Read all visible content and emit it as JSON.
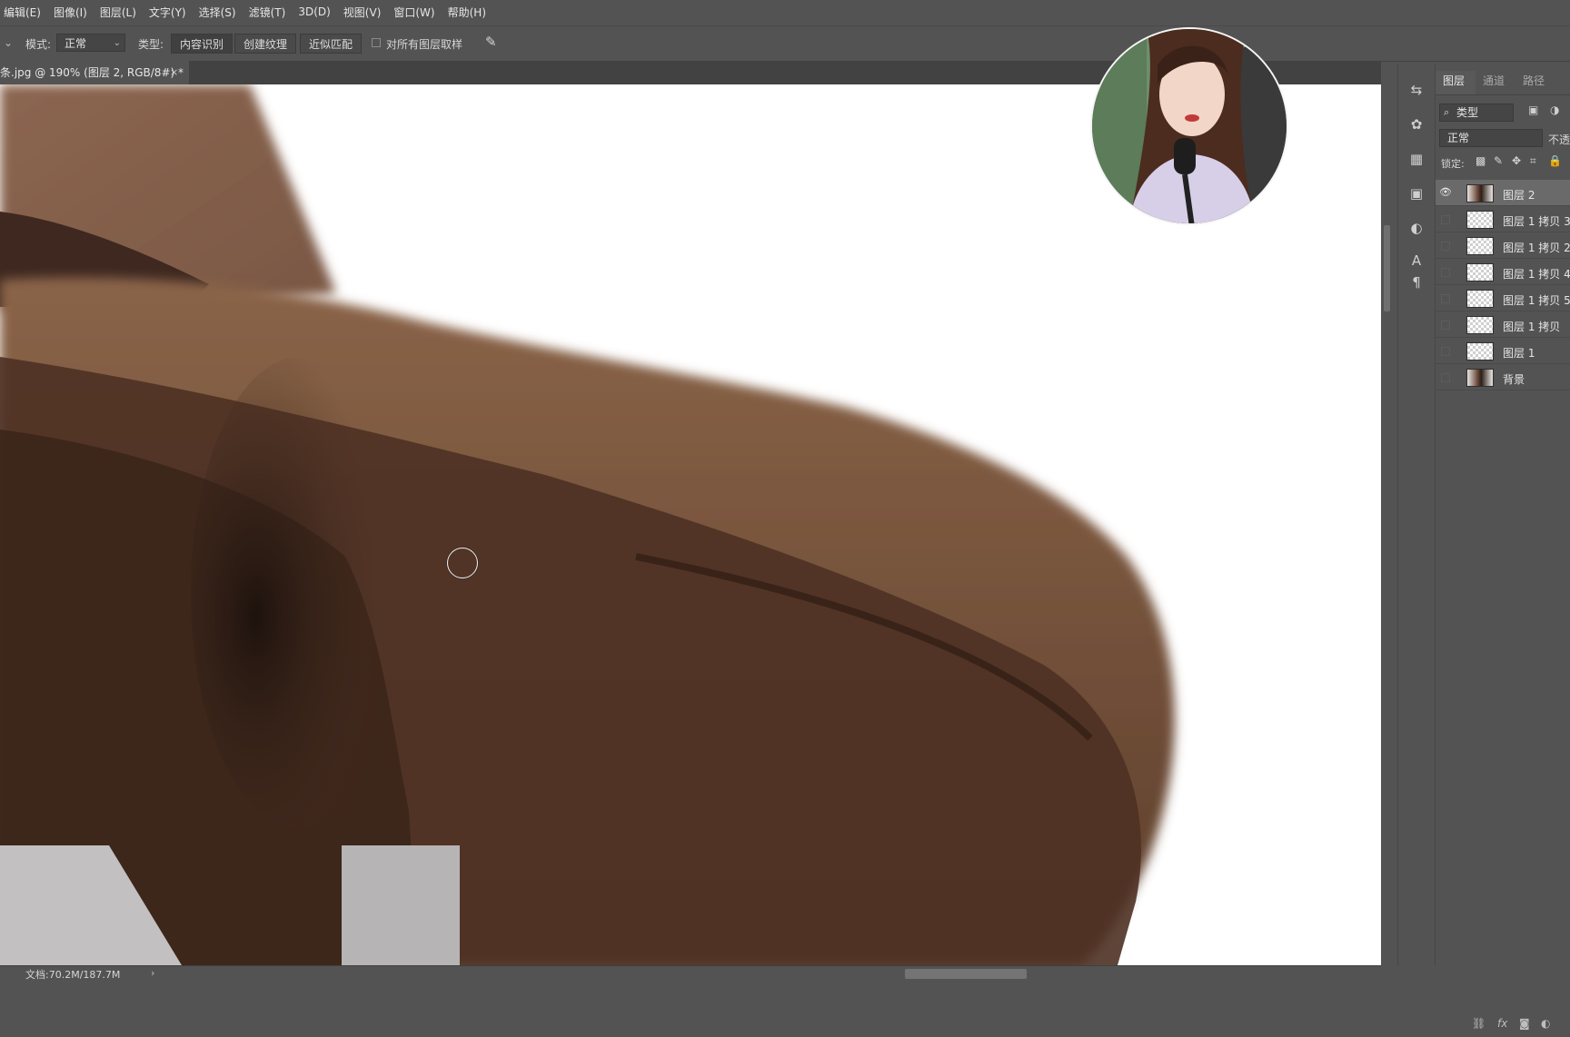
{
  "menubar": {
    "items": [
      "编辑(E)",
      "图像(I)",
      "图层(L)",
      "文字(Y)",
      "选择(S)",
      "滤镜(T)",
      "3D(D)",
      "视图(V)",
      "窗口(W)",
      "帮助(H)"
    ]
  },
  "options_bar": {
    "mode_label": "模式:",
    "mode_value": "正常",
    "type_label": "类型:",
    "type_options": [
      "内容识别",
      "创建纹理",
      "近似匹配"
    ],
    "selected_type": "内容识别",
    "sample_all_layers_label": "对所有图层取样",
    "sample_all_layers_checked": false
  },
  "document_tab": {
    "title": "条.jpg @ 190% (图层 2, RGB/8#) *",
    "close": "×"
  },
  "canvas": {
    "subject": "brown felt hat brim closeup",
    "hat_color": "#5a3a2a",
    "background_color": "#ffffff"
  },
  "status_bar": {
    "doc_info": "文档:70.2M/187.7M",
    "nav_arrow": "›"
  },
  "layers_panel": {
    "tabs": [
      "图层",
      "通道",
      "路径"
    ],
    "active_tab": "图层",
    "filter_label": "类型",
    "blend_mode": "正常",
    "opacity_label": "不透",
    "lock_label": "锁定:",
    "layers": [
      {
        "name": "图层 2",
        "visible": true,
        "selected": true,
        "thumb": "photo"
      },
      {
        "name": "图层 1 拷贝 3",
        "visible": false,
        "selected": false,
        "thumb": "transparent"
      },
      {
        "name": "图层 1 拷贝 2",
        "visible": false,
        "selected": false,
        "thumb": "transparent"
      },
      {
        "name": "图层 1 拷贝 4",
        "visible": false,
        "selected": false,
        "thumb": "transparent"
      },
      {
        "name": "图层 1 拷贝 5",
        "visible": false,
        "selected": false,
        "thumb": "transparent"
      },
      {
        "name": "图层 1 拷贝",
        "visible": false,
        "selected": false,
        "thumb": "transparent"
      },
      {
        "name": "图层 1",
        "visible": false,
        "selected": false,
        "thumb": "transparent"
      },
      {
        "name": "背景",
        "visible": false,
        "selected": false,
        "thumb": "photo"
      }
    ],
    "footer_icons": [
      "link-icon",
      "fx-icon",
      "mask-icon",
      "adjustment-icon"
    ]
  },
  "webcam_overlay": {
    "description_icon": "presenter-avatar"
  }
}
